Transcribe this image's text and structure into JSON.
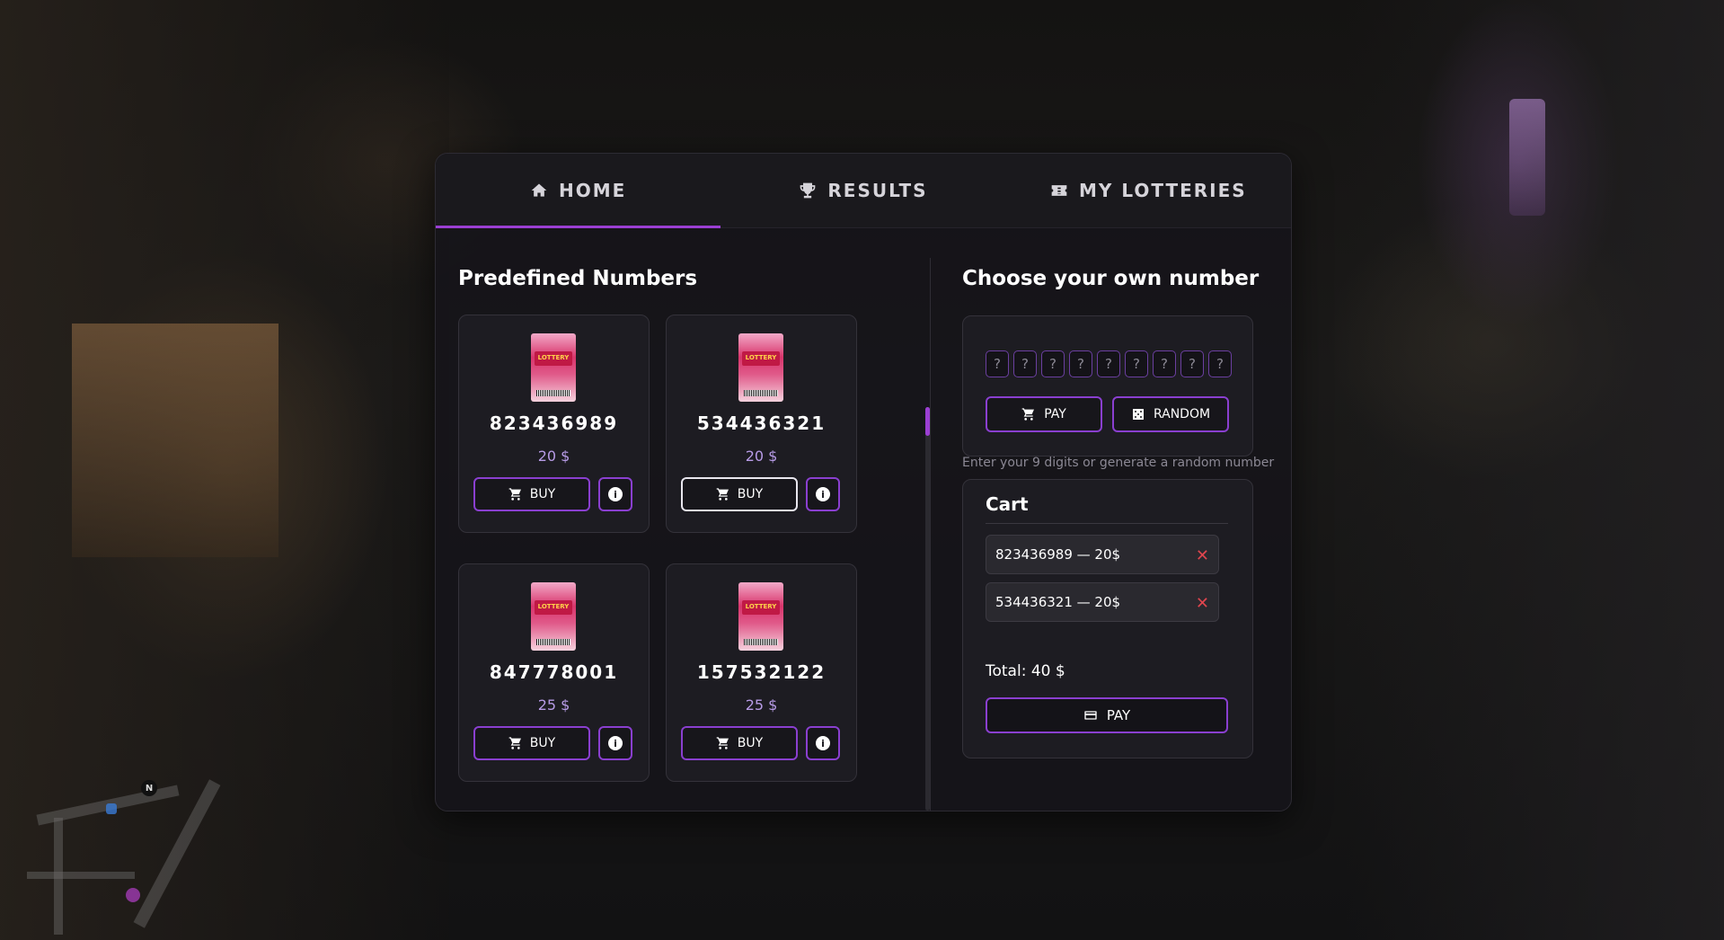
{
  "tabs": [
    {
      "label": "HOME",
      "icon": "home-icon",
      "active": true
    },
    {
      "label": "RESULTS",
      "icon": "trophy-icon",
      "active": false
    },
    {
      "label": "MY LOTTERIES",
      "icon": "ticket-icon",
      "active": false
    }
  ],
  "predefined": {
    "title": "Predefined Numbers",
    "buy_label": "BUY",
    "ticket_text": "LOTTERY",
    "cards": [
      {
        "number": "823436989",
        "price": "20 $"
      },
      {
        "number": "534436321",
        "price": "20 $"
      },
      {
        "number": "847778001",
        "price": "25 $"
      },
      {
        "number": "157532122",
        "price": "25 $"
      }
    ]
  },
  "custom": {
    "title": "Choose your own number",
    "subtitle": "Enter your 9 digits or generate a random number",
    "digits": [
      "?",
      "?",
      "?",
      "?",
      "?",
      "?",
      "?",
      "?",
      "?"
    ],
    "pay_label": "PAY",
    "random_label": "RANDOM"
  },
  "cart": {
    "title": "Cart",
    "items": [
      {
        "text": "823436989 — 20$"
      },
      {
        "text": "534436321 — 20$"
      }
    ],
    "remove_glyph": "✕",
    "total": "Total: 40 $",
    "pay_label": "PAY"
  },
  "minimap": {
    "north_label": "N"
  },
  "colors": {
    "accent": "#9b3fd3",
    "remove": "#e0454e",
    "price": "#b79be6"
  }
}
